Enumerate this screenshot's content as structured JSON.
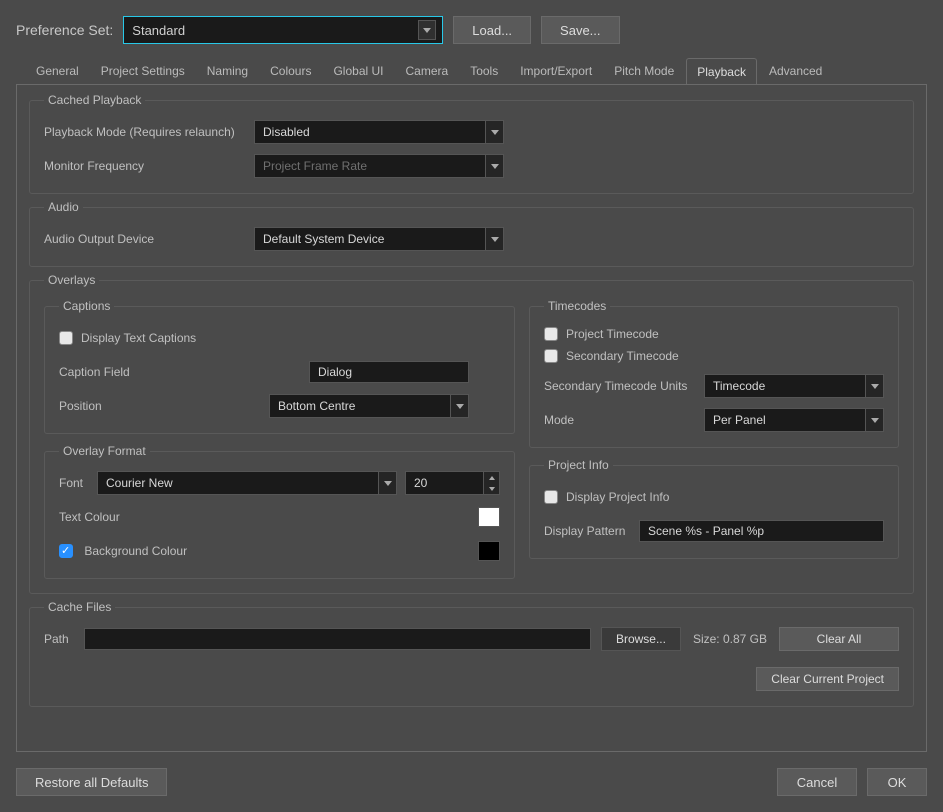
{
  "header": {
    "label": "Preference Set:",
    "preset": "Standard",
    "load": "Load...",
    "save": "Save..."
  },
  "tabs": [
    "General",
    "Project Settings",
    "Naming",
    "Colours",
    "Global UI",
    "Camera",
    "Tools",
    "Import/Export",
    "Pitch Mode",
    "Playback",
    "Advanced"
  ],
  "active_tab": "Playback",
  "cached_playback": {
    "legend": "Cached Playback",
    "playback_mode_label": "Playback Mode (Requires relaunch)",
    "playback_mode_value": "Disabled",
    "monitor_freq_label": "Monitor Frequency",
    "monitor_freq_value": "Project Frame Rate"
  },
  "audio": {
    "legend": "Audio",
    "output_label": "Audio Output Device",
    "output_value": "Default System Device"
  },
  "overlays": {
    "legend": "Overlays",
    "captions": {
      "legend": "Captions",
      "display_text_captions": "Display Text Captions",
      "display_text_captions_checked": false,
      "caption_field_label": "Caption Field",
      "caption_field_value": "Dialog",
      "position_label": "Position",
      "position_value": "Bottom Centre"
    },
    "overlay_format": {
      "legend": "Overlay Format",
      "font_label": "Font",
      "font_value": "Courier New",
      "font_size": "20",
      "text_colour_label": "Text Colour",
      "text_colour_value": "#ffffff",
      "background_colour_label": "Background Colour",
      "background_colour_checked": true,
      "background_colour_value": "#000000"
    },
    "timecodes": {
      "legend": "Timecodes",
      "project_timecode": "Project Timecode",
      "project_timecode_checked": false,
      "secondary_timecode": "Secondary Timecode",
      "secondary_timecode_checked": false,
      "secondary_units_label": "Secondary Timecode Units",
      "secondary_units_value": "Timecode",
      "mode_label": "Mode",
      "mode_value": "Per Panel"
    },
    "project_info": {
      "legend": "Project Info",
      "display_project_info": "Display Project Info",
      "display_project_info_checked": false,
      "display_pattern_label": "Display Pattern",
      "display_pattern_value": "Scene %s - Panel %p"
    }
  },
  "cache_files": {
    "legend": "Cache Files",
    "path_label": "Path",
    "path_value": "",
    "browse": "Browse...",
    "size_label": "Size: 0.87 GB",
    "clear_all": "Clear All",
    "clear_current": "Clear Current Project"
  },
  "footer": {
    "restore": "Restore all Defaults",
    "cancel": "Cancel",
    "ok": "OK"
  }
}
